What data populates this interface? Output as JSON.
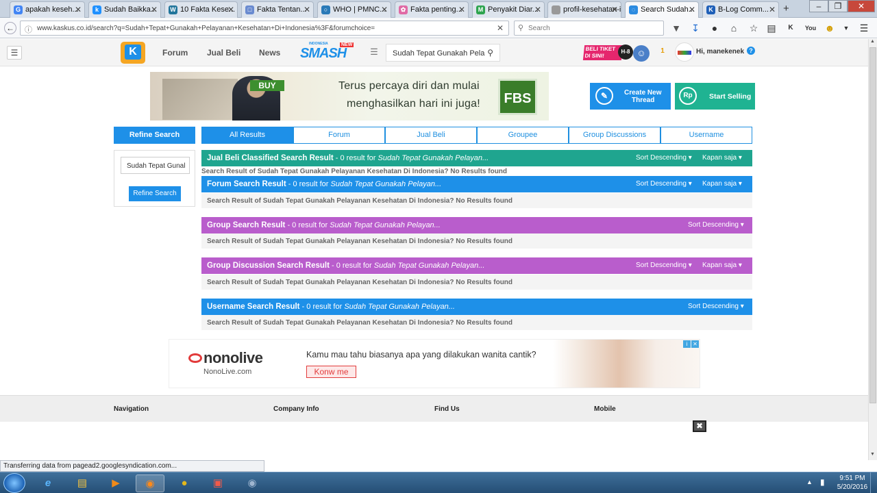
{
  "browser": {
    "tabs": [
      {
        "label": "apakah keseh...",
        "color": "#4285f4",
        "glyph": "G"
      },
      {
        "label": "Sudah Baikka...",
        "color": "#1e90ff",
        "glyph": "k"
      },
      {
        "label": "10 Fakta Kese...",
        "color": "#21759b",
        "glyph": "W"
      },
      {
        "label": "Fakta Tentan...",
        "color": "#6a8bd0",
        "glyph": "□"
      },
      {
        "label": "WHO | PMNC...",
        "color": "#2a7ab8",
        "glyph": "○"
      },
      {
        "label": "Fakta penting...",
        "color": "#e06aa5",
        "glyph": "✿"
      },
      {
        "label": "Penyakit Diar...",
        "color": "#2ea44f",
        "glyph": "M"
      },
      {
        "label": "profil-kesehatan-i...",
        "color": "#999999",
        "glyph": ""
      },
      {
        "label": "Search Sudah...",
        "color": "#2c8be0",
        "glyph": "◌"
      },
      {
        "label": "B-Log Comm...",
        "color": "#1e5fb8",
        "glyph": "K"
      }
    ],
    "new_tab_symbol": "+",
    "url": "www.kaskus.co.id/search?q=Sudah+Tepat+Gunakah+Pelayanan+Kesehatan+Di+Indonesia%3F&forumchoice=",
    "search_placeholder": "Search",
    "status": "Transferring data from pagead2.googlesyndication.com..."
  },
  "header": {
    "logo_letter": "K",
    "nav": [
      "Forum",
      "Jual Beli",
      "News"
    ],
    "smash_small": "INDONESIA",
    "smash_text": "SMASH",
    "smash_badge": "NEW",
    "search_value": "Sudah Tepat Gunakah Pela",
    "promo_line1": "BELI TIKET",
    "promo_line2": "DI SINI!",
    "promo_badge": "H-8",
    "notif_count": "1",
    "greeting": "Hi, manekenek",
    "help": "?"
  },
  "banner": {
    "buy": "BUY",
    "line1": "Terus percaya diri dan mulai",
    "line2": "menghasilkan hari ini juga!",
    "brand": "FBS"
  },
  "actions": {
    "create_thread_1": "Create New",
    "create_thread_2": "Thread",
    "start_selling": "Start Selling",
    "rp": "Rp"
  },
  "sidebar": {
    "title": "Refine Search",
    "input_value": "Sudah Tepat Gunal",
    "button": "Refine Search"
  },
  "tabs": [
    "All Results",
    "Forum",
    "Jual Beli",
    "Groupee",
    "Group Discussions",
    "Username"
  ],
  "sections": [
    {
      "title": "Jual Beli Classified Search Result",
      "count": " - 0 result for ",
      "query": "Sudah Tepat Gunakah Pelayan...",
      "sort": "Sort Descending",
      "time": "Kapan saja",
      "color": "#1fa58f"
    },
    {
      "title": "Forum Search Result",
      "count": " - 0 result for ",
      "query": "Sudah Tepat Gunakah Pelayan...",
      "sort": "Sort Descending",
      "time": "Kapan saja",
      "color": "#1e90e8"
    },
    {
      "title": "Group Search Result",
      "count": " - 0 result for ",
      "query": "Sudah Tepat Gunakah Pelayan...",
      "sort": "Sort Descending",
      "time": "",
      "color": "#b95dcc"
    },
    {
      "title": "Group Discussion Search Result",
      "count": " - 0 result for ",
      "query": "Sudah Tepat Gunakah Pelayan...",
      "sort": "Sort Descending",
      "time": "Kapan saja",
      "color": "#b95dcc"
    },
    {
      "title": "Username Search Result",
      "count": " - 0 result for ",
      "query": "Sudah Tepat Gunakah Pelayan...",
      "sort": "Sort Descending",
      "time": "",
      "color": "#1e90e8"
    }
  ],
  "no_result": "Search Result of Sudah Tepat Gunakah Pelayanan Kesehatan Di Indonesia? No Results found",
  "ad": {
    "brand": "nonolive",
    "domain": "NonoLive.com",
    "question": "Kamu mau tahu biasanya apa yang dilakukan wanita cantik?",
    "cta": "Konw me"
  },
  "footer": [
    "Navigation",
    "Company Info",
    "Find Us",
    "Mobile"
  ],
  "clock": {
    "time": "9:51 PM",
    "date": "5/20/2016"
  },
  "taskbar_apps": [
    "start-orb",
    "internet-explorer",
    "file-explorer",
    "media-player",
    "firefox",
    "chrome",
    "app-red",
    "chrome-alt"
  ]
}
